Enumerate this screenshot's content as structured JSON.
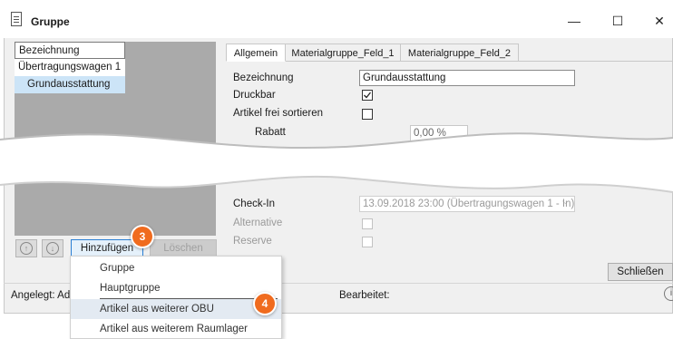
{
  "window": {
    "title": "Gruppe",
    "minimize_glyph": "—",
    "maximize_glyph": "☐",
    "close_glyph": "✕"
  },
  "tree": {
    "items": [
      {
        "label": "Bezeichnung"
      },
      {
        "label": "Übertragungswagen 1"
      },
      {
        "label": "Grundausstattung"
      }
    ]
  },
  "tabs": [
    {
      "label": "Allgemein"
    },
    {
      "label": "Materialgruppe_Feld_1"
    },
    {
      "label": "Materialgruppe_Feld_2"
    }
  ],
  "form": {
    "bezeichnung_label": "Bezeichnung",
    "bezeichnung_value": "Grundausstattung",
    "druckbar_label": "Druckbar",
    "druckbar_checked": true,
    "sortieren_label": "Artikel frei sortieren",
    "rabatt_label": "Rabatt",
    "rabatt_value": "0,00 %",
    "checkin_label": "Check-In",
    "checkin_value": "13.09.2018 23:00 (Übertragungswagen 1 - In)",
    "alternative_label": "Alternative",
    "reserve_label": "Reserve"
  },
  "buttons": {
    "up_glyph": "↑",
    "down_glyph": "↓",
    "hinzufuegen": "Hinzufügen",
    "loeschen": "Löschen",
    "schliessen": "Schließen"
  },
  "badges": {
    "step_add": "3",
    "step_menu": "4"
  },
  "status": {
    "angelegt": "Angelegt: Ad",
    "bearbeitet": "Bearbeitet:"
  },
  "menu": {
    "items": [
      {
        "label": "Gruppe"
      },
      {
        "label": "Hauptgruppe"
      },
      {
        "label": "Artikel aus weiterer OBU"
      },
      {
        "label": "Artikel aus weiterem Raumlager"
      }
    ]
  },
  "colors": {
    "badge": "#f06b1e",
    "selection": "#cce4f7",
    "tree_bg": "#aaaaaa"
  }
}
